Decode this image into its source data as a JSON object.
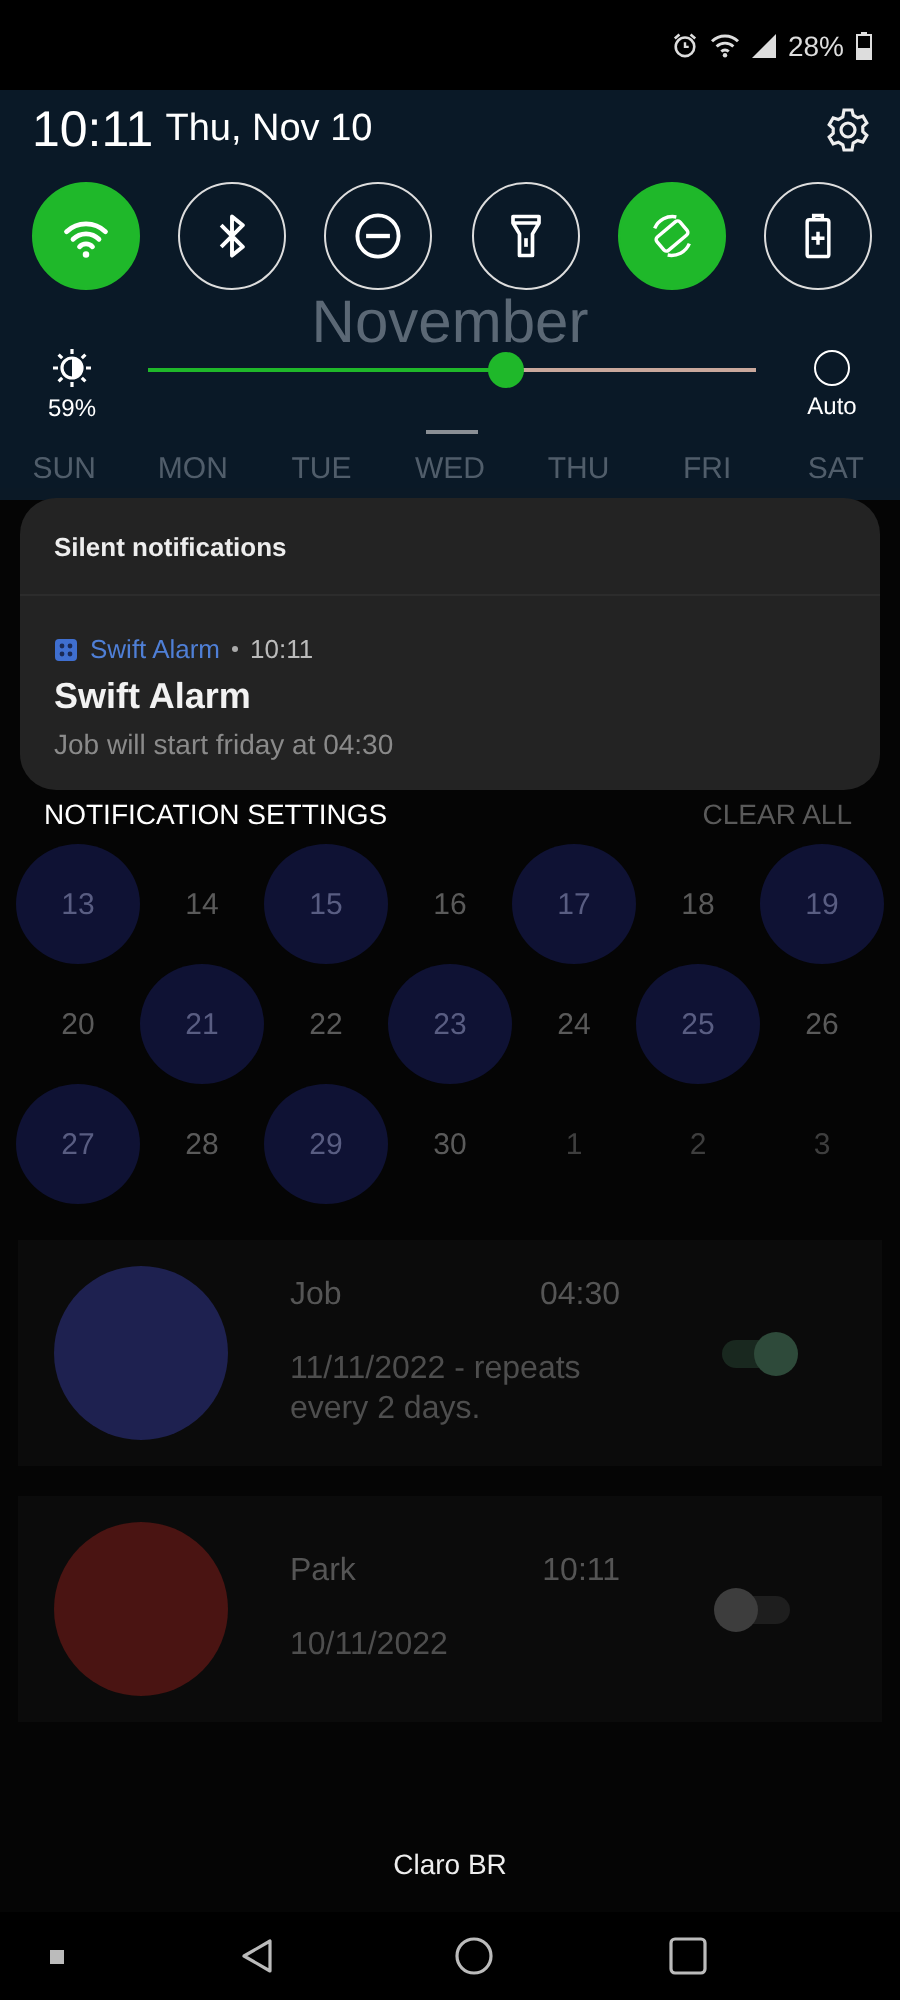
{
  "status_bar": {
    "battery": "28%"
  },
  "app": {
    "month": "November",
    "weekdays": [
      "SUN",
      "MON",
      "TUE",
      "WED",
      "THU",
      "FRI",
      "SAT"
    ],
    "days": [
      {
        "label": "13",
        "marked": true,
        "muted": false
      },
      {
        "label": "14",
        "marked": false,
        "muted": false
      },
      {
        "label": "15",
        "marked": true,
        "muted": false
      },
      {
        "label": "16",
        "marked": false,
        "muted": false
      },
      {
        "label": "17",
        "marked": true,
        "muted": false
      },
      {
        "label": "18",
        "marked": false,
        "muted": false
      },
      {
        "label": "19",
        "marked": true,
        "muted": false
      },
      {
        "label": "20",
        "marked": false,
        "muted": false
      },
      {
        "label": "21",
        "marked": true,
        "muted": false
      },
      {
        "label": "22",
        "marked": false,
        "muted": false
      },
      {
        "label": "23",
        "marked": true,
        "muted": false
      },
      {
        "label": "24",
        "marked": false,
        "muted": false
      },
      {
        "label": "25",
        "marked": true,
        "muted": false
      },
      {
        "label": "26",
        "marked": false,
        "muted": false
      },
      {
        "label": "27",
        "marked": true,
        "muted": false
      },
      {
        "label": "28",
        "marked": false,
        "muted": false
      },
      {
        "label": "29",
        "marked": true,
        "muted": false
      },
      {
        "label": "30",
        "marked": false,
        "muted": false
      },
      {
        "label": "1",
        "marked": false,
        "muted": true
      },
      {
        "label": "2",
        "marked": false,
        "muted": true
      },
      {
        "label": "3",
        "marked": false,
        "muted": true
      }
    ],
    "alarms": [
      {
        "name": "Job",
        "time": "04:30",
        "details": "11/11/2022 - repeats every 2 days.",
        "color": "#1e2150",
        "enabled": true
      },
      {
        "name": "Park",
        "time": "10:11",
        "details": "10/11/2022",
        "color": "#4a1412",
        "enabled": false
      }
    ]
  },
  "shade": {
    "time": "10:11",
    "date": "Thu, Nov 10",
    "tiles": [
      {
        "kind": "wifi",
        "on": true
      },
      {
        "kind": "bluetooth",
        "on": false
      },
      {
        "kind": "do-not-disturb",
        "on": false
      },
      {
        "kind": "flashlight",
        "on": false
      },
      {
        "kind": "rotation",
        "on": true
      },
      {
        "kind": "battery-saver",
        "on": false
      }
    ],
    "brightness": {
      "level": 0.59,
      "reading": "59%",
      "auto_label": "Auto",
      "auto": false
    },
    "notification_group": {
      "header": "Silent notifications",
      "notifications": [
        {
          "app": "Swift Alarm",
          "time": "10:11",
          "title": "Swift Alarm",
          "text": "Job will start friday at 04:30"
        }
      ]
    },
    "settings_button": "NOTIFICATION SETTINGS",
    "clear_button": {
      "label": "CLEAR ALL",
      "disabled": true
    },
    "carrier": "Claro BR"
  }
}
